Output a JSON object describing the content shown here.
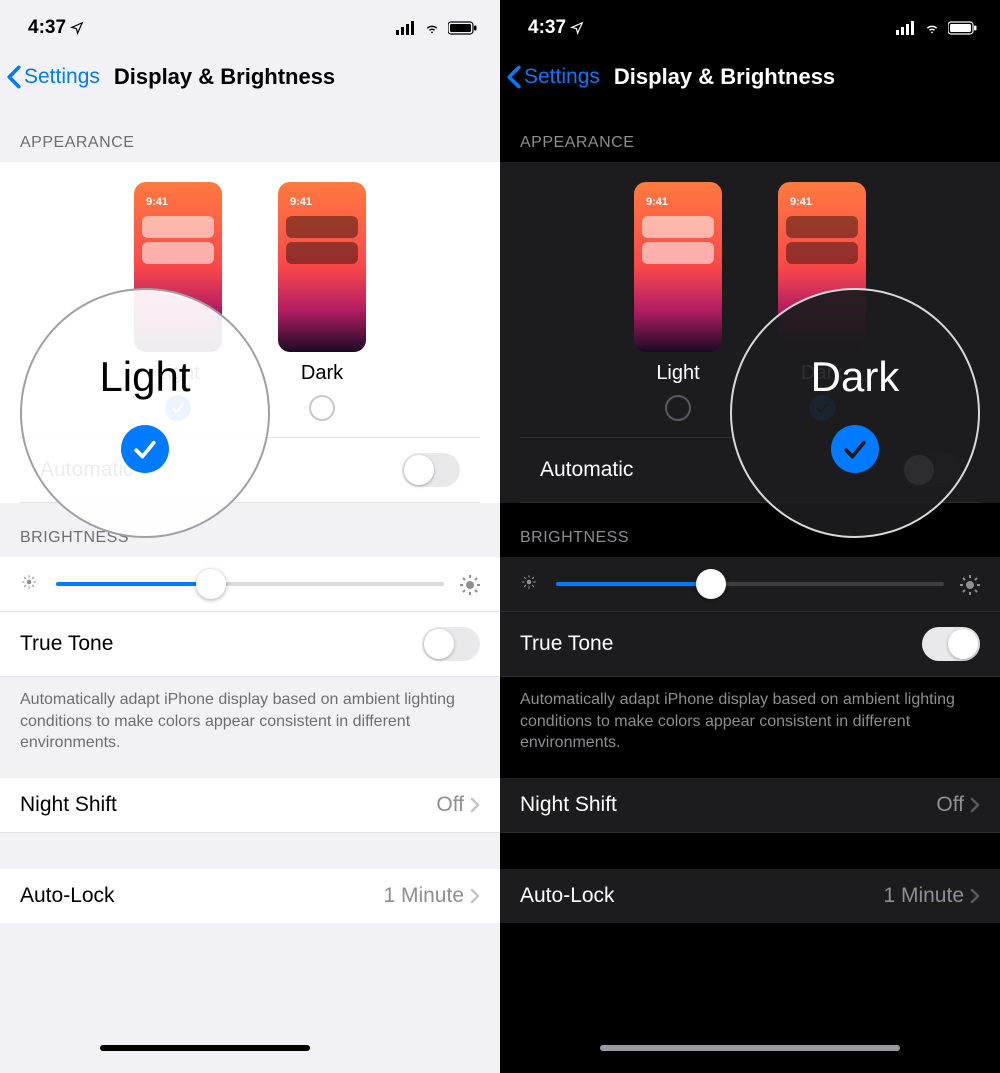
{
  "shared": {
    "status_time": "4:37",
    "back_label": "Settings",
    "page_title": "Display & Brightness",
    "section_appearance": "APPEARANCE",
    "mode_light": "Light",
    "mode_dark": "Dark",
    "thumb_time": "9:41",
    "automatic_label": "Automatic",
    "section_brightness": "BRIGHTNESS",
    "brightness_pct": 40,
    "true_tone_label": "True Tone",
    "true_tone_note": "Automatically adapt iPhone display based on ambient lighting conditions to make colors appear consistent in different environments.",
    "night_shift_label": "Night Shift",
    "night_shift_value": "Off",
    "auto_lock_label": "Auto-Lock",
    "auto_lock_value": "1 Minute"
  },
  "leftZoom": "Light",
  "rightZoom": "Dark"
}
